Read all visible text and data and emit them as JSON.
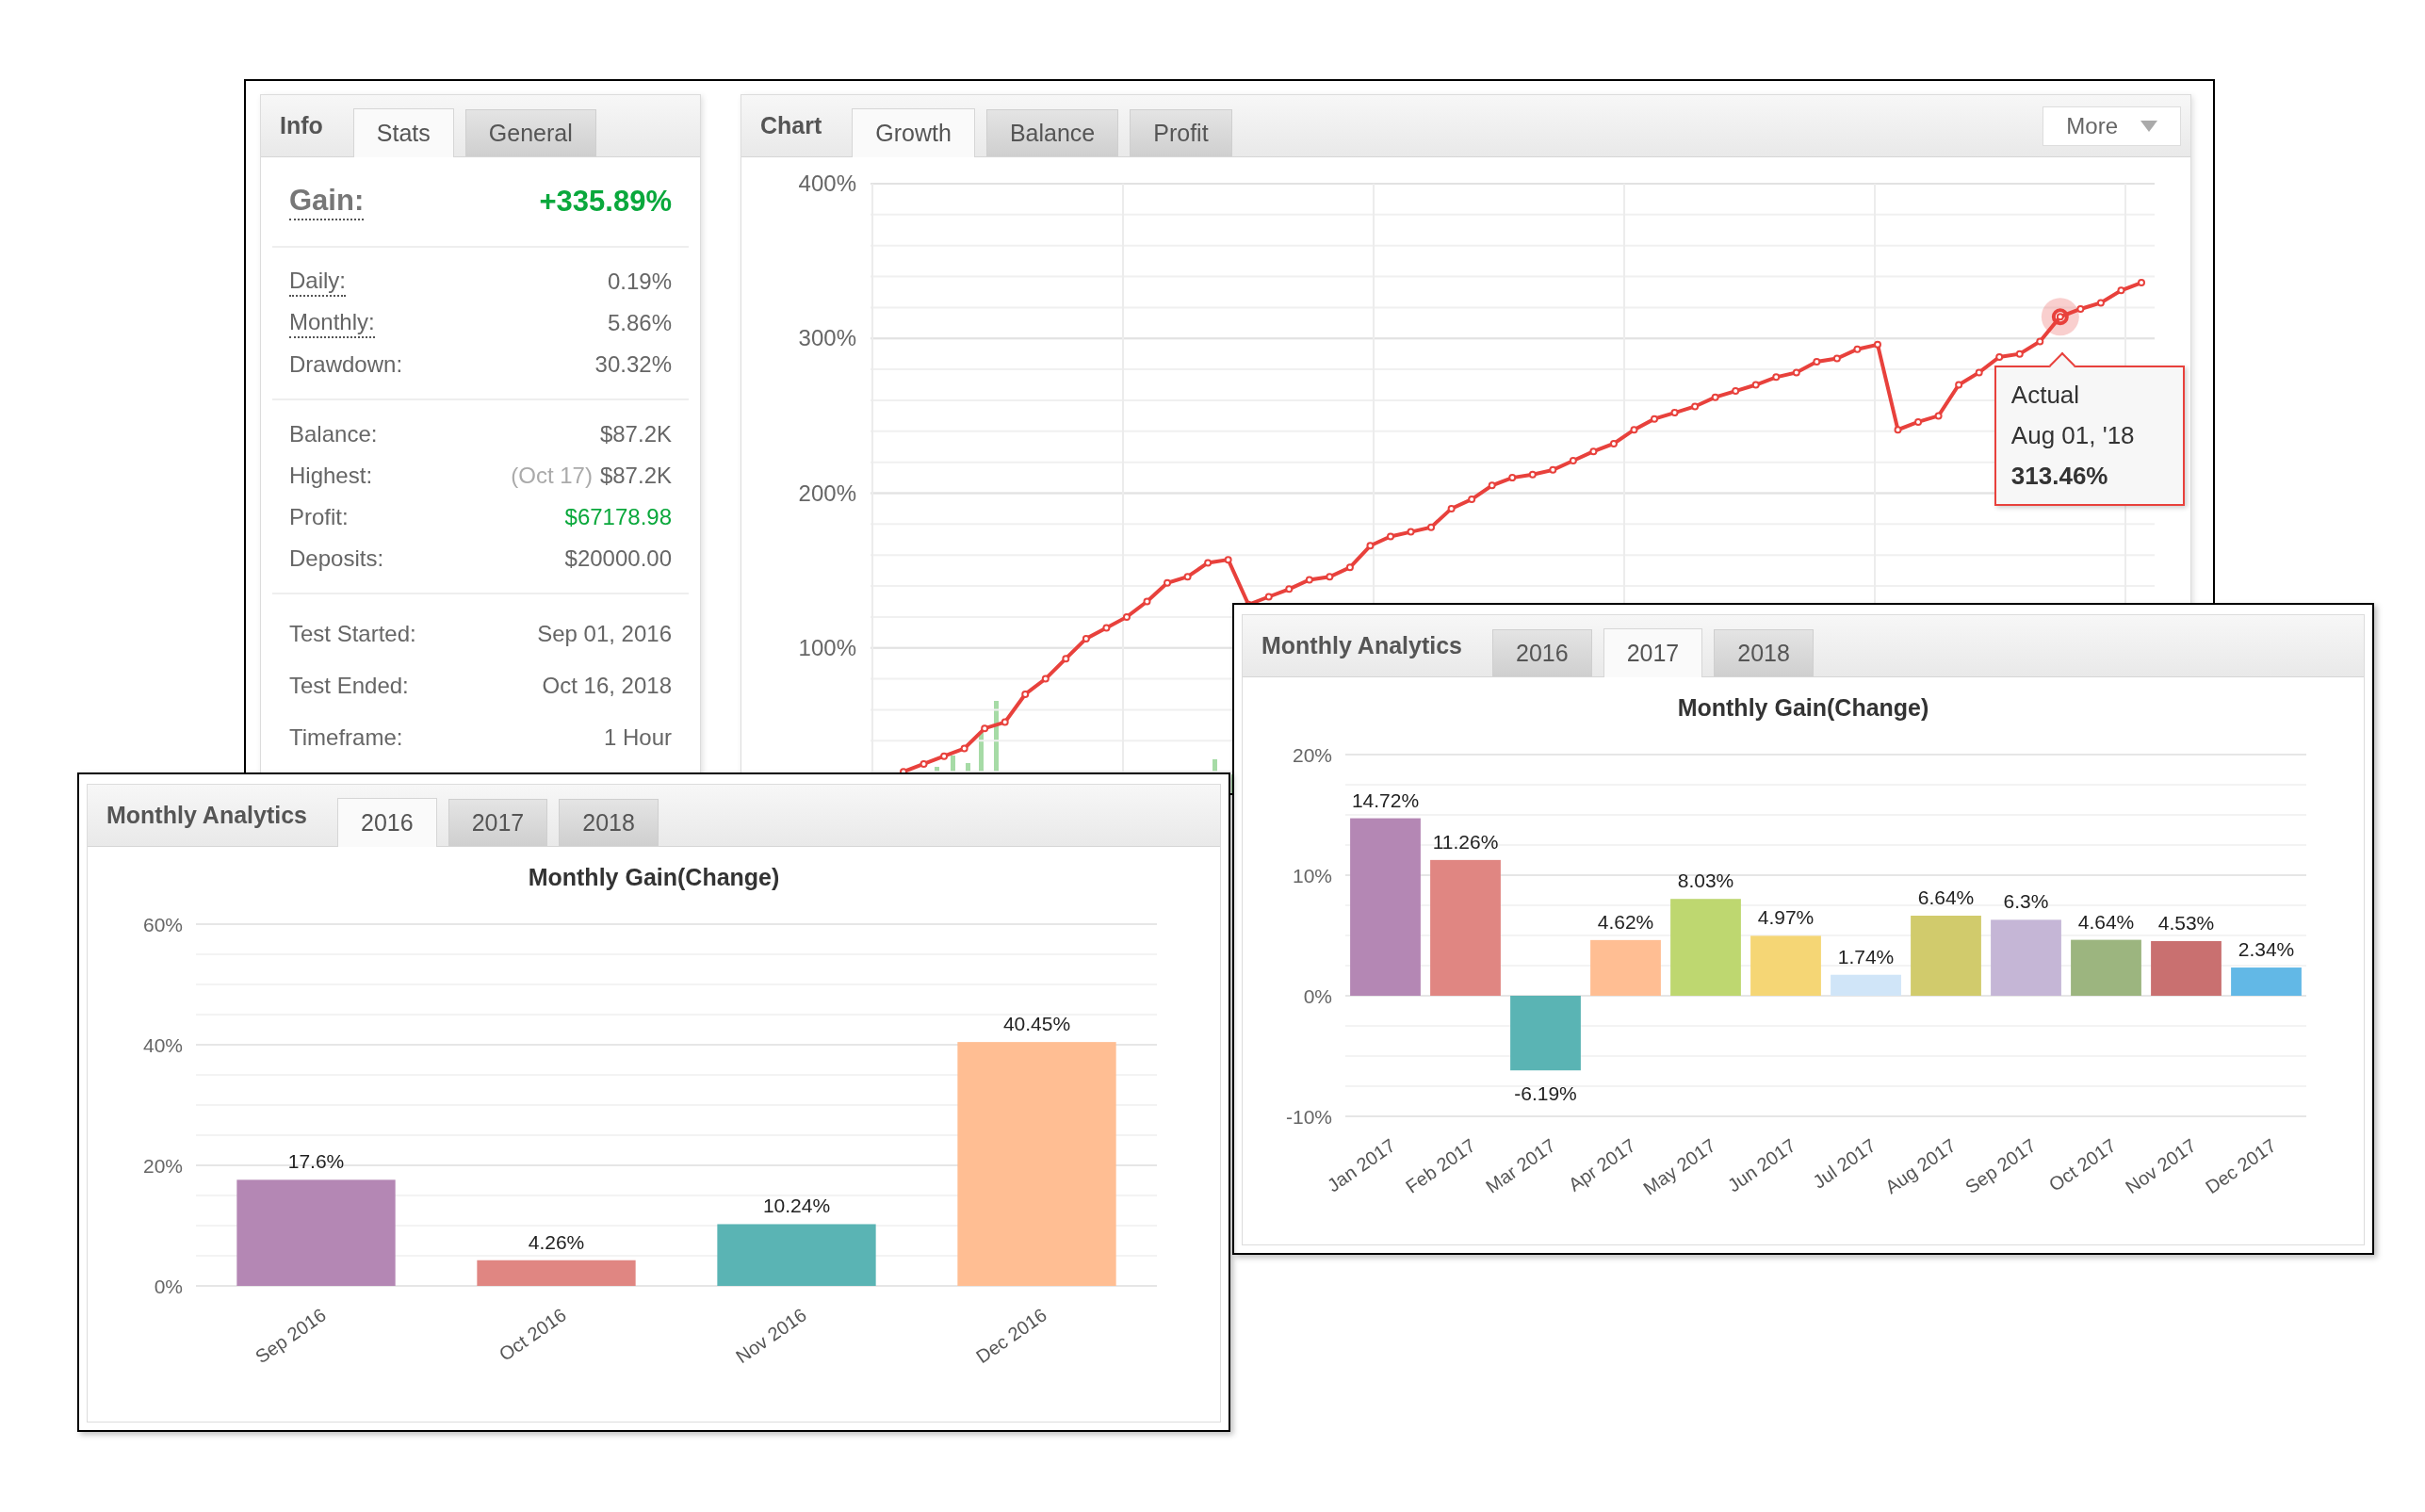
{
  "info_panel": {
    "heading": "Info",
    "tabs": [
      {
        "label": "Stats",
        "selected": true
      },
      {
        "label": "General",
        "selected": false
      }
    ],
    "gain": {
      "label": "Gain:",
      "value": "+335.89%"
    },
    "groups": [
      {
        "rows": [
          {
            "label": "Daily:",
            "value": "0.19%",
            "kind": "hint"
          },
          {
            "label": "Monthly:",
            "value": "5.86%",
            "kind": "hint"
          },
          {
            "label": "Drawdown:",
            "value": "30.32%",
            "kind": "plain"
          }
        ]
      },
      {
        "rows": [
          {
            "label": "Balance:",
            "value": "$87.2K",
            "kind": "plain"
          },
          {
            "label": "Highest:",
            "note": "(Oct 17)",
            "value": "$87.2K",
            "kind": "plain"
          },
          {
            "label": "Profit:",
            "value": "$67178.98",
            "kind": "positive"
          },
          {
            "label": "Deposits:",
            "value": "$20000.00",
            "kind": "plain"
          }
        ]
      },
      {
        "rows": [
          {
            "label": "Test Started:",
            "value": "Sep 01, 2016",
            "kind": "plain"
          },
          {
            "label": "Test Ended:",
            "value": "Oct 16, 2018",
            "kind": "plain"
          },
          {
            "label": "Timeframe:",
            "value": "1 Hour",
            "kind": "plain"
          }
        ]
      }
    ]
  },
  "chart_panel": {
    "heading": "Chart",
    "tabs": [
      {
        "label": "Growth",
        "selected": true
      },
      {
        "label": "Balance",
        "selected": false
      },
      {
        "label": "Profit",
        "selected": false
      }
    ],
    "more_button": "More",
    "chart_data": {
      "type": "line",
      "grid": true,
      "ylim": [
        0,
        400
      ],
      "yticks": [
        {
          "value": 100,
          "label": "100%"
        },
        {
          "value": 200,
          "label": "200%"
        },
        {
          "value": 300,
          "label": "300%"
        },
        {
          "value": 400,
          "label": "400%"
        }
      ],
      "series": [
        {
          "name": "Actual",
          "color": "#e8413c",
          "marker": true,
          "values": [
            20,
            25,
            30,
            35,
            48,
            52,
            70,
            80,
            93,
            106,
            113,
            120,
            130,
            142,
            146,
            155,
            157,
            128,
            133,
            138,
            144,
            146,
            152,
            166,
            172,
            175,
            178,
            190,
            196,
            205,
            210,
            212,
            215,
            221,
            227,
            232,
            241,
            248,
            252,
            256,
            262,
            266,
            270,
            275,
            278,
            285,
            287,
            293,
            296,
            241,
            246,
            250,
            270,
            278,
            288,
            290,
            298,
            314,
            319,
            323,
            331,
            336
          ]
        }
      ]
    },
    "tooltip": {
      "date": "Aug 01, '18",
      "value": "313.46%"
    }
  },
  "analytics_windows": [
    {
      "heading": "Monthly Analytics",
      "tabs": [
        {
          "label": "2016",
          "selected": false
        },
        {
          "label": "2017",
          "selected": true
        },
        {
          "label": "2018",
          "selected": false
        }
      ],
      "bars": [
        {
          "color": "#b487b4"
        },
        {
          "color": "#e08682"
        },
        {
          "color": "#5ab4b4"
        },
        {
          "color": "#ffbe93"
        },
        {
          "color": "#bed770"
        },
        {
          "color": "#f5d675"
        },
        {
          "color": "#d0e5f8"
        },
        {
          "color": "#d1cb6c"
        },
        {
          "color": "#c5b6d6"
        },
        {
          "color": "#9cb57f"
        },
        {
          "color": "#c97070"
        },
        {
          "color": "#62b8e6"
        }
      ],
      "chart_data": {
        "type": "bar",
        "title": "Monthly Gain(Change)",
        "grid": true,
        "categories": [
          "Jan 2017",
          "Feb 2017",
          "Mar 2017",
          "Apr 2017",
          "May 2017",
          "Jun 2017",
          "Jul 2017",
          "Aug 2017",
          "Sep 2017",
          "Oct 2017",
          "Nov 2017",
          "Dec 2017"
        ],
        "series": [
          {
            "values": [
              14.72,
              11.26,
              -6.19,
              4.62,
              8.03,
              4.97,
              1.74,
              6.64,
              6.3,
              4.64,
              4.53,
              2.34
            ]
          }
        ],
        "ylim": [
          -10,
          20
        ],
        "yticks": [
          {
            "value": -10,
            "label": "-10%"
          },
          {
            "value": 0,
            "label": "0%"
          },
          {
            "value": 10,
            "label": "10%"
          },
          {
            "value": 20,
            "label": "20%"
          }
        ],
        "value_labels": [
          "14.72%",
          "11.26%",
          "-6.19%",
          "4.62%",
          "8.03%",
          "4.97%",
          "1.74%",
          "6.64%",
          "6.3%",
          "4.64%",
          "4.53%",
          "2.34%"
        ]
      }
    },
    {
      "heading": "Monthly Analytics",
      "tabs": [
        {
          "label": "2016",
          "selected": true
        },
        {
          "label": "2017",
          "selected": false
        },
        {
          "label": "2018",
          "selected": false
        }
      ],
      "bars": [
        {
          "color": "#b487b4"
        },
        {
          "color": "#e08682"
        },
        {
          "color": "#5ab4b4"
        },
        {
          "color": "#ffbe93"
        }
      ],
      "chart_data": {
        "type": "bar",
        "title": "Monthly Gain(Change)",
        "grid": true,
        "categories": [
          "Sep 2016",
          "Oct 2016",
          "Nov 2016",
          "Dec 2016"
        ],
        "series": [
          {
            "values": [
              17.6,
              4.26,
              10.24,
              40.45
            ]
          }
        ],
        "ylim": [
          0,
          60
        ],
        "yticks": [
          {
            "value": 0,
            "label": "0%"
          },
          {
            "value": 20,
            "label": "20%"
          },
          {
            "value": 40,
            "label": "40%"
          },
          {
            "value": 60,
            "label": "60%"
          }
        ],
        "value_labels": [
          "17.6%",
          "4.26%",
          "10.24%",
          "40.45%"
        ]
      }
    }
  ]
}
